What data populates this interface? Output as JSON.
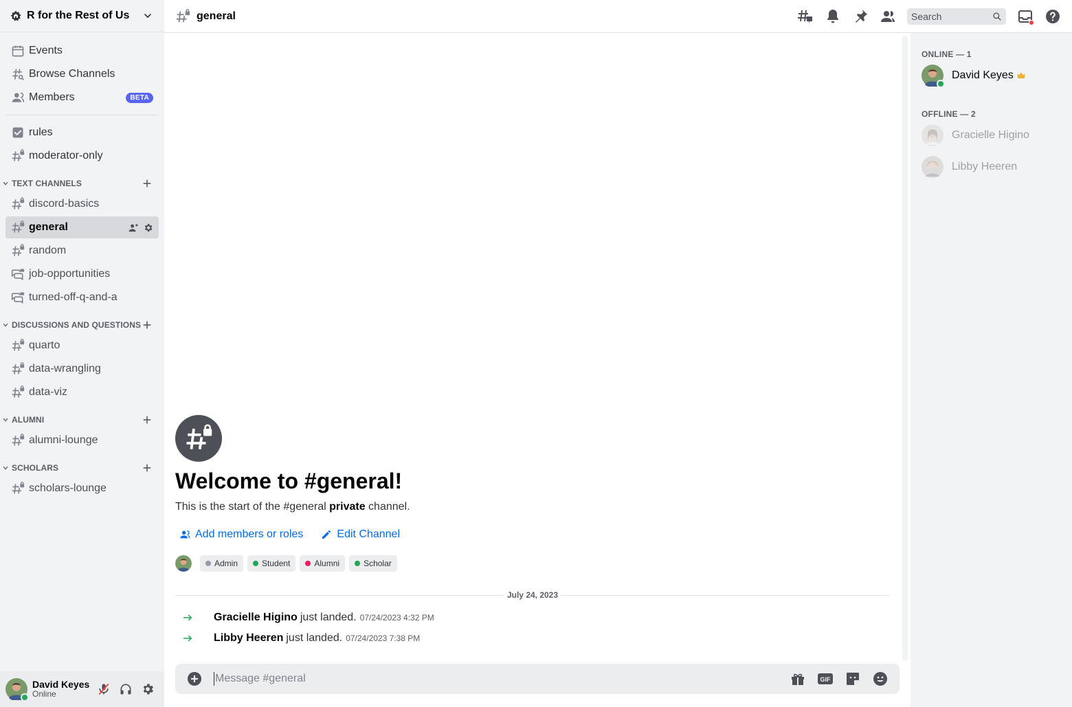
{
  "server": {
    "name": "R for the Rest of Us"
  },
  "nav": {
    "events": "Events",
    "browse": "Browse Channels",
    "members": "Members",
    "members_badge": "BETA"
  },
  "top_channels": [
    {
      "label": "rules",
      "icon": "rules-icon"
    },
    {
      "label": "moderator-only",
      "icon": "locked-hash-icon"
    }
  ],
  "categories": [
    {
      "name": "TEXT CHANNELS",
      "channels": [
        {
          "label": "discord-basics",
          "icon": "locked-hash-icon",
          "active": false
        },
        {
          "label": "general",
          "icon": "locked-hash-icon",
          "active": true
        },
        {
          "label": "random",
          "icon": "locked-hash-icon",
          "active": false
        },
        {
          "label": "job-opportunities",
          "icon": "locked-forum-icon",
          "active": false
        },
        {
          "label": "turned-off-q-and-a",
          "icon": "locked-forum-icon",
          "active": false
        }
      ]
    },
    {
      "name": "DISCUSSIONS AND QUESTIONS",
      "channels": [
        {
          "label": "quarto",
          "icon": "locked-hash-icon"
        },
        {
          "label": "data-wrangling",
          "icon": "locked-hash-icon"
        },
        {
          "label": "data-viz",
          "icon": "locked-hash-icon"
        }
      ]
    },
    {
      "name": "ALUMNI",
      "channels": [
        {
          "label": "alumni-lounge",
          "icon": "locked-hash-icon"
        }
      ]
    },
    {
      "name": "SCHOLARS",
      "channels": [
        {
          "label": "scholars-lounge",
          "icon": "locked-hash-icon"
        }
      ]
    }
  ],
  "user": {
    "name": "David Keyes",
    "status": "Online"
  },
  "header": {
    "channel": "general",
    "search_placeholder": "Search"
  },
  "welcome": {
    "title": "Welcome to #general!",
    "sub_pre": "This is the start of the #general ",
    "sub_bold": "private",
    "sub_post": " channel.",
    "add_members": "Add members or roles",
    "edit_channel": "Edit Channel"
  },
  "roles": [
    {
      "name": "Admin",
      "color": "#949ba4"
    },
    {
      "name": "Student",
      "color": "#23a55a"
    },
    {
      "name": "Alumni",
      "color": "#e91e63"
    },
    {
      "name": "Scholar",
      "color": "#23a55a"
    }
  ],
  "date_divider": "July 24, 2023",
  "messages": [
    {
      "name": "Gracielle Higino",
      "text": "just landed.",
      "time": "07/24/2023 4:32 PM"
    },
    {
      "name": "Libby Heeren",
      "text": "just landed.",
      "time": "07/24/2023 7:38 PM"
    }
  ],
  "composer": {
    "placeholder": "Message #general",
    "gif": "GIF"
  },
  "members_panel": {
    "online_header": "ONLINE — 1",
    "offline_header": "OFFLINE — 2",
    "online": [
      {
        "name": "David Keyes",
        "owner": true
      }
    ],
    "offline": [
      {
        "name": "Gracielle Higino"
      },
      {
        "name": "Libby Heeren"
      }
    ]
  },
  "colors": {
    "accent": "#5865f2",
    "link": "#006ce7",
    "online": "#23a55a"
  }
}
